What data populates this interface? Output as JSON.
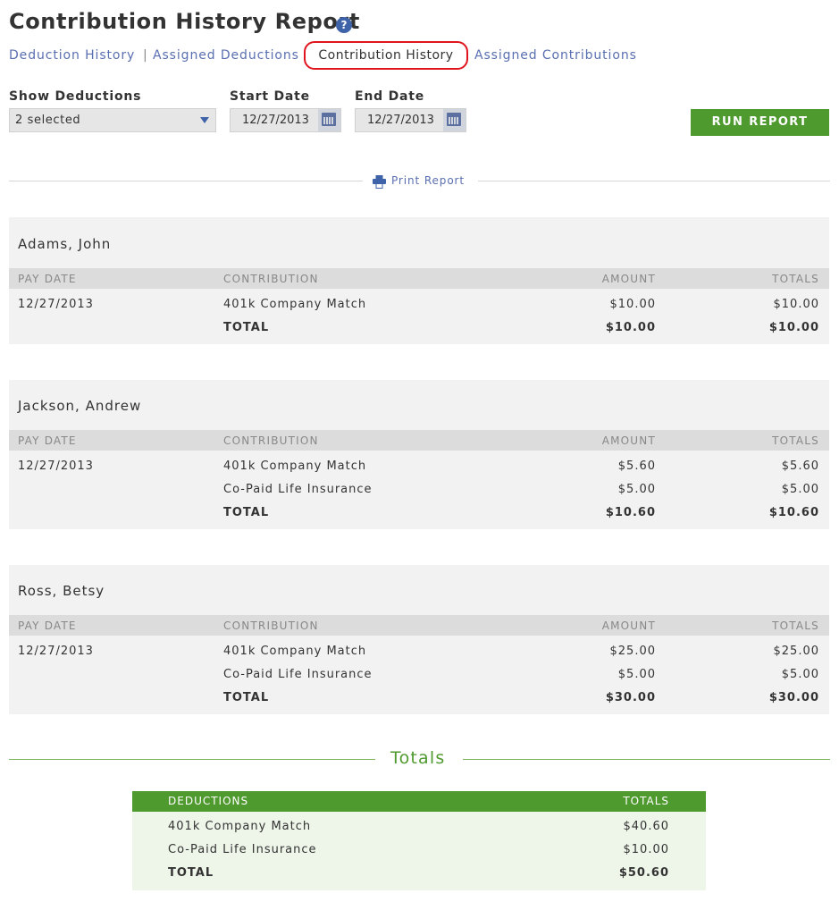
{
  "header": {
    "title": "Contribution History Report",
    "help_glyph": "?"
  },
  "nav": {
    "links": [
      "Deduction History",
      "Assigned Deductions",
      "Contribution History",
      "Assigned Contributions"
    ],
    "separator": "|",
    "active_index": 2
  },
  "filters": {
    "show_deductions_label": "Show Deductions",
    "show_deductions_value": "2 selected",
    "start_date_label": "Start Date",
    "start_date_value": "12/27/2013",
    "end_date_label": "End Date",
    "end_date_value": "12/27/2013",
    "run_button": "RUN REPORT"
  },
  "print_label": "Print Report",
  "columns": {
    "pay_date": "PAY DATE",
    "contribution": "CONTRIBUTION",
    "amount": "AMOUNT",
    "totals": "TOTALS"
  },
  "employees": [
    {
      "name": "Adams, John",
      "pay_date": "12/27/2013",
      "rows": [
        {
          "contribution": "401k Company Match",
          "amount": "$10.00",
          "total": "$10.00"
        }
      ],
      "total_label": "TOTAL",
      "total_amount": "$10.00",
      "total_total": "$10.00"
    },
    {
      "name": "Jackson, Andrew",
      "pay_date": "12/27/2013",
      "rows": [
        {
          "contribution": "401k Company Match",
          "amount": "$5.60",
          "total": "$5.60"
        },
        {
          "contribution": "Co-Paid Life Insurance",
          "amount": "$5.00",
          "total": "$5.00"
        }
      ],
      "total_label": "TOTAL",
      "total_amount": "$10.60",
      "total_total": "$10.60"
    },
    {
      "name": "Ross, Betsy",
      "pay_date": "12/27/2013",
      "rows": [
        {
          "contribution": "401k Company Match",
          "amount": "$25.00",
          "total": "$25.00"
        },
        {
          "contribution": "Co-Paid Life Insurance",
          "amount": "$5.00",
          "total": "$5.00"
        }
      ],
      "total_label": "TOTAL",
      "total_amount": "$30.00",
      "total_total": "$30.00"
    }
  ],
  "summary": {
    "title": "Totals",
    "col_deductions": "DEDUCTIONS",
    "col_totals": "TOTALS",
    "rows": [
      {
        "name": "401k Company Match",
        "total": "$40.60"
      },
      {
        "name": "Co-Paid Life Insurance",
        "total": "$10.00"
      }
    ],
    "total_label": "TOTAL",
    "total_value": "$50.60"
  },
  "colors": {
    "accent_green": "#4f9a2f",
    "link_blue": "#5a6fb0",
    "active_outline": "#e0141e"
  }
}
